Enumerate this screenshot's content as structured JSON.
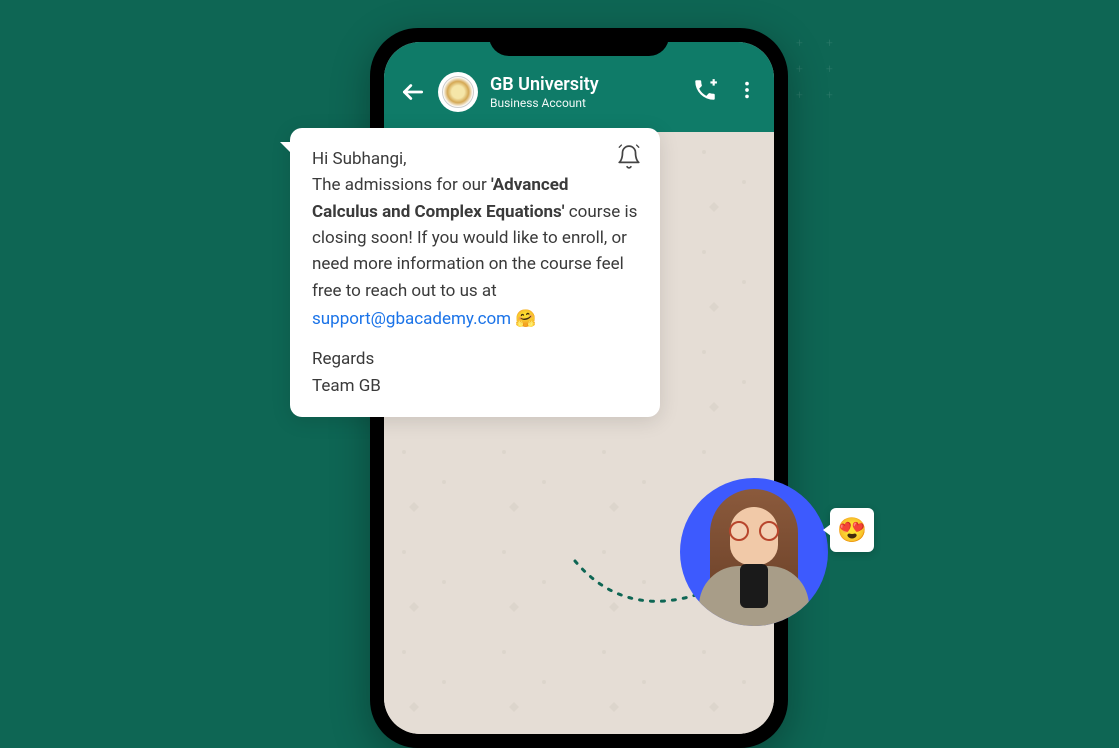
{
  "header": {
    "contact_name": "GB University",
    "contact_subtitle": "Business Account"
  },
  "message": {
    "greeting": "Hi Subhangi,",
    "line1_pre": "The admissions for our ",
    "bold_text": "'Advanced Calculus and Complex Equations'",
    "line1_post": " course is closing soon! If you would like to enroll, or need more information on the course feel free to reach out to us at",
    "email": "support@gbacademy.com",
    "emoji": "🤗",
    "sig_line1": "Regards",
    "sig_line2": "Team GB"
  },
  "callout_emoji": "😍"
}
